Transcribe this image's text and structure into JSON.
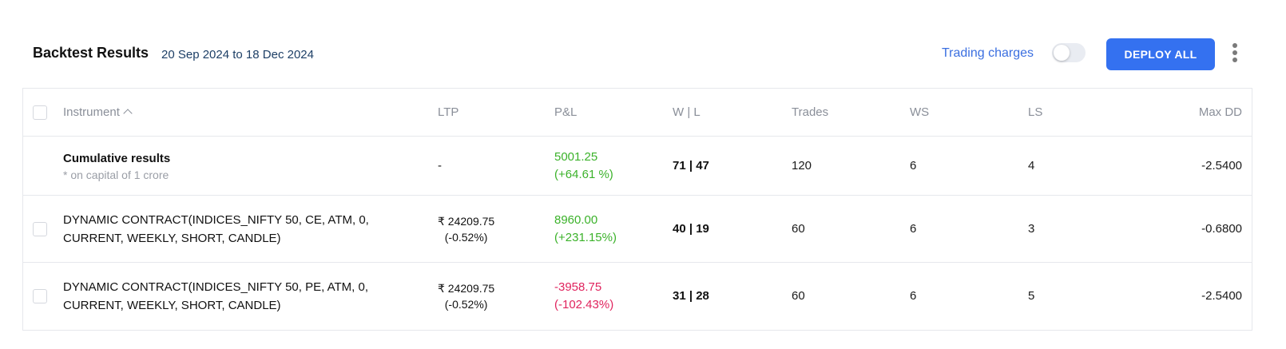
{
  "header": {
    "title": "Backtest Results",
    "date_range": "20 Sep 2024 to 18 Dec 2024",
    "trading_charges_label": "Trading charges",
    "trading_charges_enabled": false,
    "deploy_all_label": "DEPLOY ALL"
  },
  "table": {
    "columns": {
      "instrument": "Instrument",
      "ltp": "LTP",
      "pnl": "P&L",
      "wl": "W | L",
      "trades": "Trades",
      "ws": "WS",
      "ls": "LS",
      "max_dd": "Max DD"
    },
    "cumulative": {
      "title": "Cumulative results",
      "note": "* on capital of 1 crore",
      "ltp": "-",
      "pnl": "5001.25",
      "pnl_pct": "(+64.61 %)",
      "wl": "71 | 47",
      "trades": "120",
      "ws": "6",
      "ls": "4",
      "max_dd": "-2.5400"
    },
    "rows": [
      {
        "instrument": "DYNAMIC CONTRACT(INDICES_NIFTY 50, CE, ATM, 0, CURRENT, WEEKLY, SHORT, CANDLE)",
        "ltp": "₹ 24209.75",
        "ltp_change": "(-0.52%)",
        "pnl": "8960.00",
        "pnl_pct": "(+231.15%)",
        "wl": "40 | 19",
        "trades": "60",
        "ws": "6",
        "ls": "3",
        "max_dd": "-0.6800"
      },
      {
        "instrument": "DYNAMIC CONTRACT(INDICES_NIFTY 50, PE, ATM, 0, CURRENT, WEEKLY, SHORT, CANDLE)",
        "ltp": "₹ 24209.75",
        "ltp_change": "(-0.52%)",
        "pnl": "-3958.75",
        "pnl_pct": "(-102.43%)",
        "wl": "31 | 28",
        "trades": "60",
        "ws": "6",
        "ls": "5",
        "max_dd": "-2.5400"
      }
    ]
  },
  "colors": {
    "accent": "#3471f0",
    "profit": "#3bb22a",
    "loss": "#e0245e"
  },
  "icons": {
    "sort": "chevron-up-icon",
    "menu": "kebab-menu-icon"
  }
}
